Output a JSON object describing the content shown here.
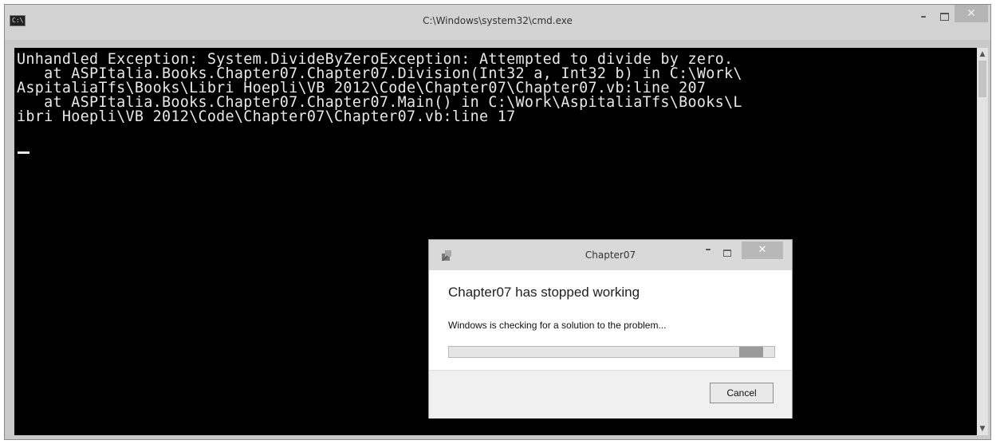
{
  "window": {
    "title": "C:\\Windows\\system32\\cmd.exe",
    "icon_text": "C:\\",
    "min_glyph": "–",
    "close_glyph": "✕"
  },
  "console": {
    "lines": [
      "Unhandled Exception: System.DivideByZeroException: Attempted to divide by zero.",
      "   at ASPItalia.Books.Chapter07.Chapter07.Division(Int32 a, Int32 b) in C:\\Work\\",
      "AspitaliaTfs\\Books\\Libri Hoepli\\VB 2012\\Code\\Chapter07\\Chapter07.vb:line 207",
      "   at ASPItalia.Books.Chapter07.Chapter07.Main() in C:\\Work\\AspitaliaTfs\\Books\\L",
      "ibri Hoepli\\VB 2012\\Code\\Chapter07\\Chapter07.vb:line 17"
    ]
  },
  "scrollbar": {
    "up_glyph": "▲",
    "down_glyph": "▼"
  },
  "dialog": {
    "title": "Chapter07",
    "heading": "Chapter07 has stopped working",
    "message": "Windows is checking for a solution to the problem...",
    "cancel_label": "Cancel",
    "min_glyph": "–",
    "close_glyph": "✕",
    "progress_fraction": 0.93
  },
  "colors": {
    "console_bg": "#000000",
    "console_fg": "#e8e8e8",
    "titlebar": "#d3d3d3"
  }
}
